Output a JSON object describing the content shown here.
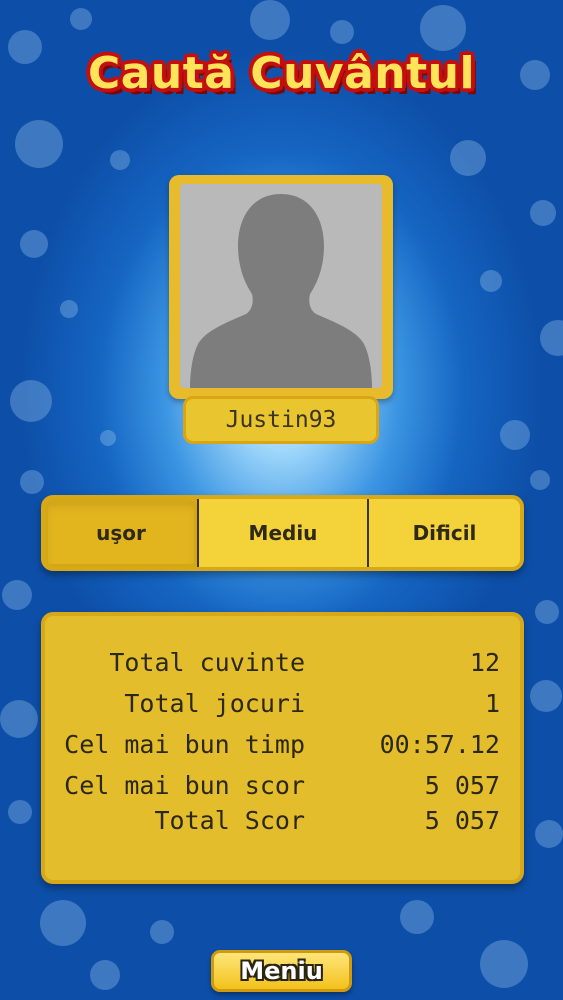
{
  "app": {
    "title": "Caută Cuvântul"
  },
  "profile": {
    "username": "Justin93",
    "avatar_icon": "person-silhouette-icon"
  },
  "difficulty_tabs": [
    {
      "label": "uşor",
      "selected": true
    },
    {
      "label": "Mediu",
      "selected": false
    },
    {
      "label": "Dificil",
      "selected": false
    }
  ],
  "stats": [
    {
      "label": "Total cuvinte",
      "value": "12"
    },
    {
      "label": "Total jocuri",
      "value": "1"
    },
    {
      "label": "Cel mai bun timp",
      "value": "00:57.12"
    },
    {
      "label": "Cel mai bun scor",
      "value": "5 057"
    },
    {
      "label": "Total Scor",
      "value": "5 057"
    }
  ],
  "footer": {
    "menu_label": "Meniu"
  },
  "colors": {
    "accent": "#e9c530",
    "title_fill": "#ffe45a",
    "title_outline": "#c40f0f",
    "background": "#1565c2"
  }
}
